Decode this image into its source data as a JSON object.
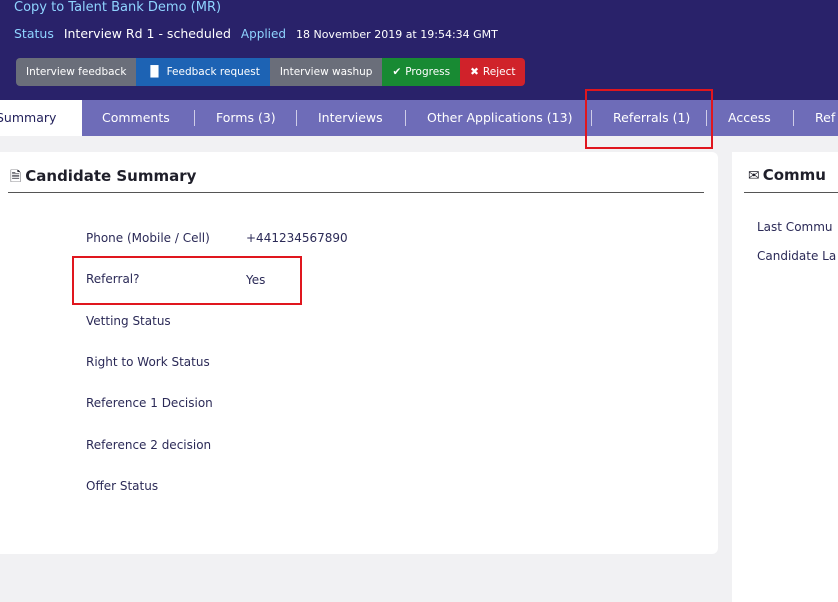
{
  "header": {
    "title": "Copy to Talent Bank Demo (MR)",
    "status_key": "Status",
    "status_value": "Interview Rd 1 - scheduled",
    "applied_label": "Applied",
    "applied_timestamp": "18 November 2019 at 19:54:34 GMT"
  },
  "actions": {
    "interview_feedback": "Interview feedback",
    "feedback_request": "Feedback request",
    "interview_washup": "Interview washup",
    "progress": "Progress",
    "reject": "Reject"
  },
  "tabs": [
    {
      "label": "Summary",
      "active": true
    },
    {
      "label": "Comments"
    },
    {
      "label": "Forms (3)"
    },
    {
      "label": "Interviews"
    },
    {
      "label": "Other Applications (13)"
    },
    {
      "label": "Referrals (1)"
    },
    {
      "label": "Access"
    },
    {
      "label": "Ref"
    }
  ],
  "summary": {
    "title": "Candidate Summary",
    "rows": [
      {
        "label": "Phone (Mobile / Cell)",
        "value": "+441234567890"
      },
      {
        "label": "Referral?",
        "value": "Yes"
      },
      {
        "label": "Vetting Status",
        "value": ""
      },
      {
        "label": "Right to Work Status",
        "value": ""
      },
      {
        "label": "Reference 1 Decision",
        "value": ""
      },
      {
        "label": "Reference 2 decision",
        "value": ""
      },
      {
        "label": "Offer Status",
        "value": ""
      }
    ]
  },
  "communications": {
    "title": "Commu",
    "lines": [
      "Last Commu",
      "Candidate La"
    ]
  },
  "colors": {
    "header_bg": "#29226a",
    "tab_bar": "#6e6cb8",
    "highlight": "#e0161e",
    "progress": "#188a33",
    "reject": "#d0222a",
    "feedback_request": "#1d63b4"
  }
}
